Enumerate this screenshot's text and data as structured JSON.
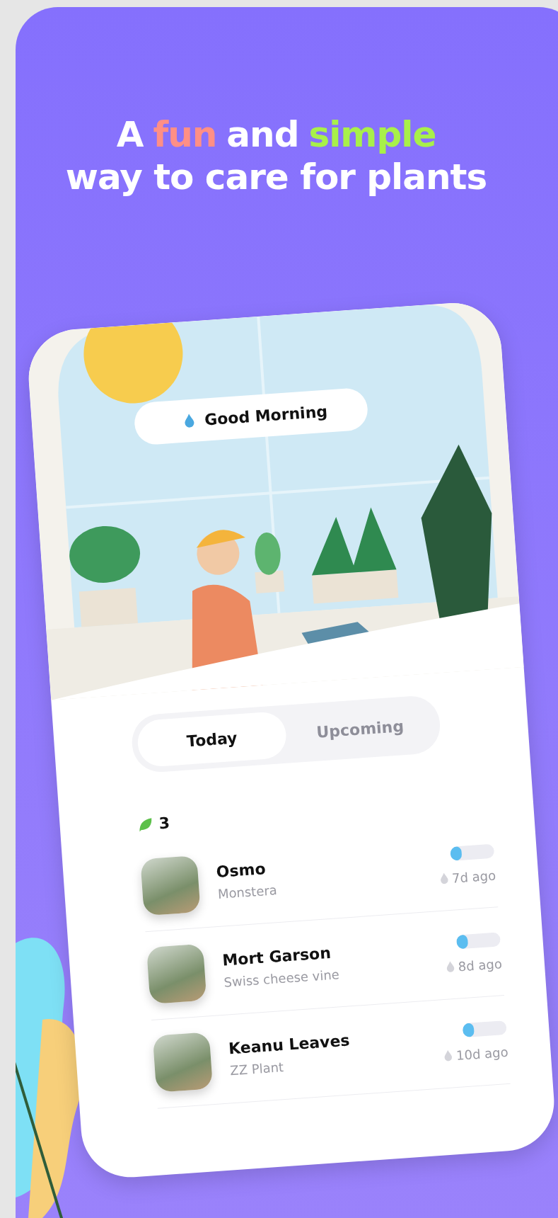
{
  "headline": {
    "lines": [
      [
        {
          "text": "A"
        },
        {
          "text": "fun",
          "color": "#ff8f86"
        },
        {
          "text": "and"
        },
        {
          "text": "simple",
          "color": "#a8f04a"
        }
      ],
      [
        {
          "text": "way to care for plants"
        }
      ]
    ]
  },
  "greeting": "Good Morning",
  "tabs": [
    {
      "label": "Today",
      "selected": true
    },
    {
      "label": "Upcoming",
      "selected": false
    }
  ],
  "plant_count": "3",
  "plants": [
    {
      "name": "Osmo",
      "species": "Monstera",
      "watered": "7d ago",
      "level": 0.25
    },
    {
      "name": "Mort Garson",
      "species": "Swiss cheese vine",
      "watered": "8d ago",
      "level": 0.25
    },
    {
      "name": "Keanu Leaves",
      "species": "ZZ Plant",
      "watered": "10d ago",
      "level": 0.25
    }
  ]
}
